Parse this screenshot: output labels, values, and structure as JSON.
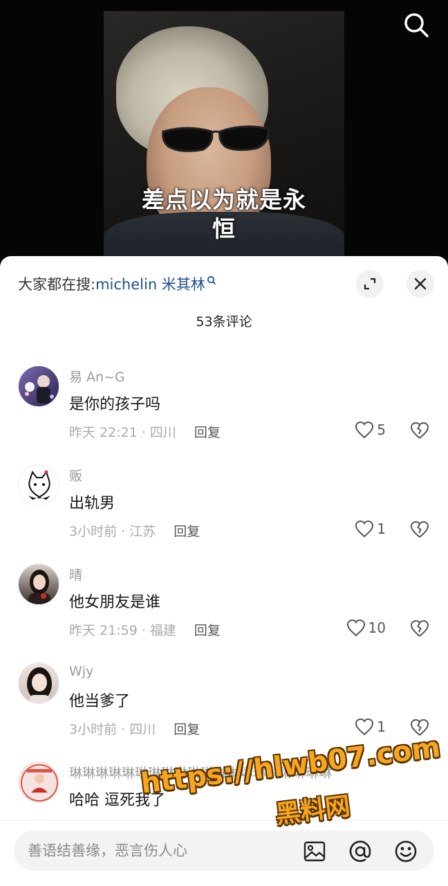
{
  "video": {
    "caption": "差点以为就是永恒"
  },
  "hot_search": {
    "prefix": "大家都在搜:",
    "keyword": "michelin 米其林"
  },
  "comment_count": "53条评论",
  "comments": [
    {
      "user": "易 An~G",
      "text": "是你的孩子吗",
      "time": "昨天 22:21 · 四川",
      "reply": "回复",
      "likes": "5",
      "avatar_color": "#5a4a8a"
    },
    {
      "user": "贩",
      "text": "出轨男",
      "time": "3小时前 · 江苏",
      "reply": "回复",
      "likes": "1",
      "avatar_color": "#ffffff"
    },
    {
      "user": "晴",
      "text": "他女朋友是谁",
      "time": "昨天 21:59 · 福建",
      "reply": "回复",
      "likes": "10",
      "avatar_color": "#3a2a24"
    },
    {
      "user": "Wjy",
      "text": "他当爹了",
      "time": "3小时前 · 四川",
      "reply": "回复",
      "likes": "1",
      "avatar_color": "#e9ddd6"
    },
    {
      "user": "琳琳琳琳琳琳琳琳琳琳琳琳琳琳琳琳琳琳琳琳",
      "text": "哈哈 逗死我了",
      "time": "",
      "reply": "",
      "likes": "",
      "avatar_color": "#f3d9d4"
    }
  ],
  "input": {
    "placeholder": "善语结善缘，恶言伤人心"
  },
  "watermark": {
    "url": "https://hlwb07.com",
    "name": "黑料网"
  },
  "colors": {
    "keyword": "#1f4f8f",
    "watermark": "#f6a623"
  }
}
